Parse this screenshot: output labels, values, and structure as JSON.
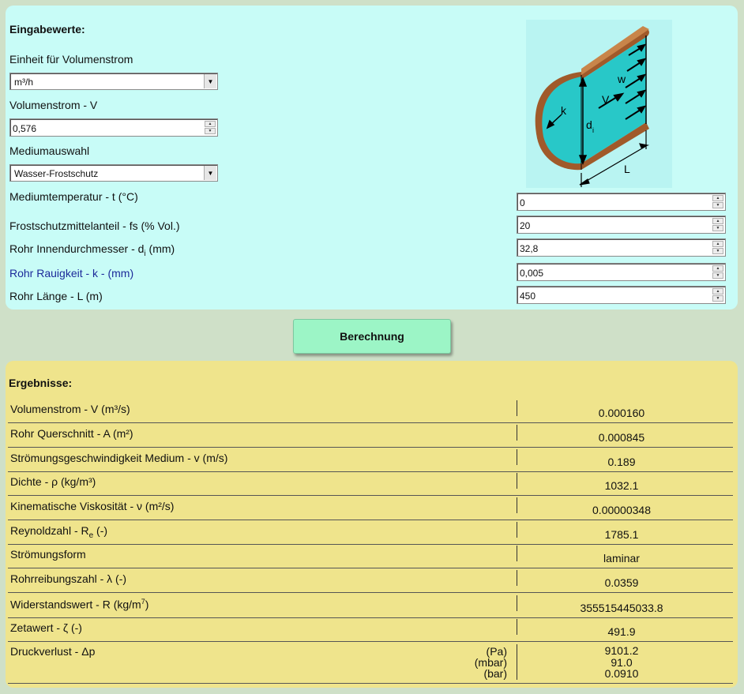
{
  "input": {
    "title": "Eingabewerte:",
    "unit_label": "Einheit für Volumenstrom",
    "unit_value": "m³/h",
    "flow_label": "Volumenstrom - V",
    "flow_value": "0,576",
    "medium_label": "Mediumauswahl",
    "medium_value": "Wasser-Frostschutz",
    "temp_label": "Mediumtemperatur - t (°C)",
    "temp_value": "0",
    "antifreeze_label": "Frostschutzmittelanteil - fs (% Vol.)",
    "antifreeze_value": "20",
    "diameter_label_main": "Rohr Innendurchmesser - d",
    "diameter_label_sub": "i",
    "diameter_label_unit": " (mm)",
    "diameter_value": "32,8",
    "roughness_label": "Rohr Rauigkeit - k - (mm)",
    "roughness_value": "0,005",
    "length_label": "Rohr Länge - L (m)",
    "length_value": "450"
  },
  "diagram": {
    "label_w": "w",
    "label_v": "V",
    "label_k": "k",
    "label_d": "d",
    "label_d_sub": "i",
    "label_l": "L"
  },
  "calc_button": "Berechnung",
  "results": {
    "title": "Ergebnisse:",
    "rows": [
      {
        "label": "Volumenstrom - V (m³/s)",
        "value": "0.000160"
      },
      {
        "label": "Rohr Querschnitt - A (m²)",
        "value": "0.000845"
      },
      {
        "label": "Strömungsgeschwindigkeit Medium - v (m/s)",
        "value": "0.189"
      },
      {
        "label": "Dichte - ρ (kg/m³)",
        "value": "1032.1"
      },
      {
        "label": "Kinematische Viskosität - ν (m²/s)",
        "value": "0.00000348"
      },
      {
        "label": "Reynoldzahl - R",
        "label_sub": "e",
        "label_tail": " (-)",
        "value": "1785.1"
      },
      {
        "label": "Strömungsform",
        "value": "laminar"
      },
      {
        "label": "Rohrreibungszahl - λ (-)",
        "value": "0.0359"
      },
      {
        "label": "Widerstandswert - R (kg/m",
        "label_sup": "7",
        "label_tail": ")",
        "value": "355515445033.8"
      },
      {
        "label": "Zetawert - ζ (-)",
        "value": "491.9"
      }
    ],
    "pressure": {
      "label": "Druckverlust - Δp",
      "units": [
        "(Pa)",
        "(mbar)",
        "(bar)"
      ],
      "values": [
        "9101.2",
        "91.0",
        "0.0910"
      ]
    }
  },
  "colors": {
    "input_panel": "#c8fcf7",
    "result_panel": "#efe48c",
    "background": "#cfe0c8",
    "button": "#9cf5c6",
    "pipe_fill": "#28c8c8",
    "pipe_wall": "#a05a2a"
  }
}
